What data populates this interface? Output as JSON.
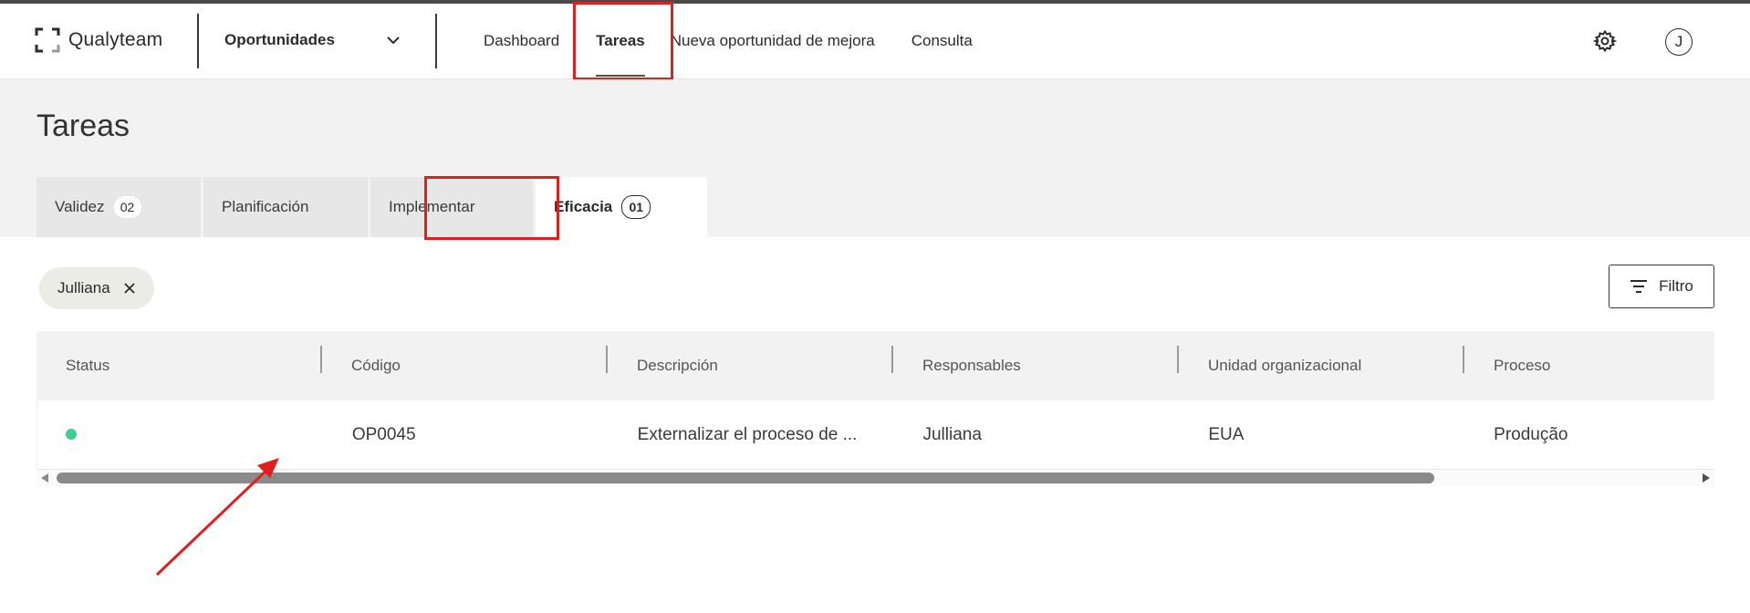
{
  "app": {
    "logo_text": "Qualyteam",
    "module": "Oportunidades"
  },
  "nav": {
    "items": [
      {
        "label": "Dashboard"
      },
      {
        "label": "Tareas",
        "active": true
      },
      {
        "label": "Nueva oportunidad de mejora"
      },
      {
        "label": "Consulta"
      }
    ]
  },
  "user": {
    "avatar_initial": "J"
  },
  "page": {
    "title": "Tareas"
  },
  "tabs": [
    {
      "label": "Validez",
      "count": "02"
    },
    {
      "label": "Planificación"
    },
    {
      "label": "Implementar"
    },
    {
      "label": "Eficacia",
      "count": "01",
      "active": true
    }
  ],
  "filters": {
    "chip_label": "Julliana",
    "button_label": "Filtro"
  },
  "table": {
    "columns": [
      "Status",
      "Código",
      "Descripción",
      "Responsables",
      "Unidad organizacional",
      "Proceso"
    ],
    "rows": [
      {
        "status": "green",
        "codigo": "OP0045",
        "descripcion": "Externalizar el proceso de ...",
        "responsables": "Julliana",
        "unidad": "EUA",
        "proceso": "Produção"
      }
    ]
  },
  "colors": {
    "status_green": "#3dcf8e",
    "highlight_red": "#e02020",
    "accent_underline": "#6b4a3a"
  },
  "icons": [
    "logo-mark-icon",
    "chevron-down-icon",
    "gear-icon",
    "close-icon",
    "filter-icon"
  ]
}
